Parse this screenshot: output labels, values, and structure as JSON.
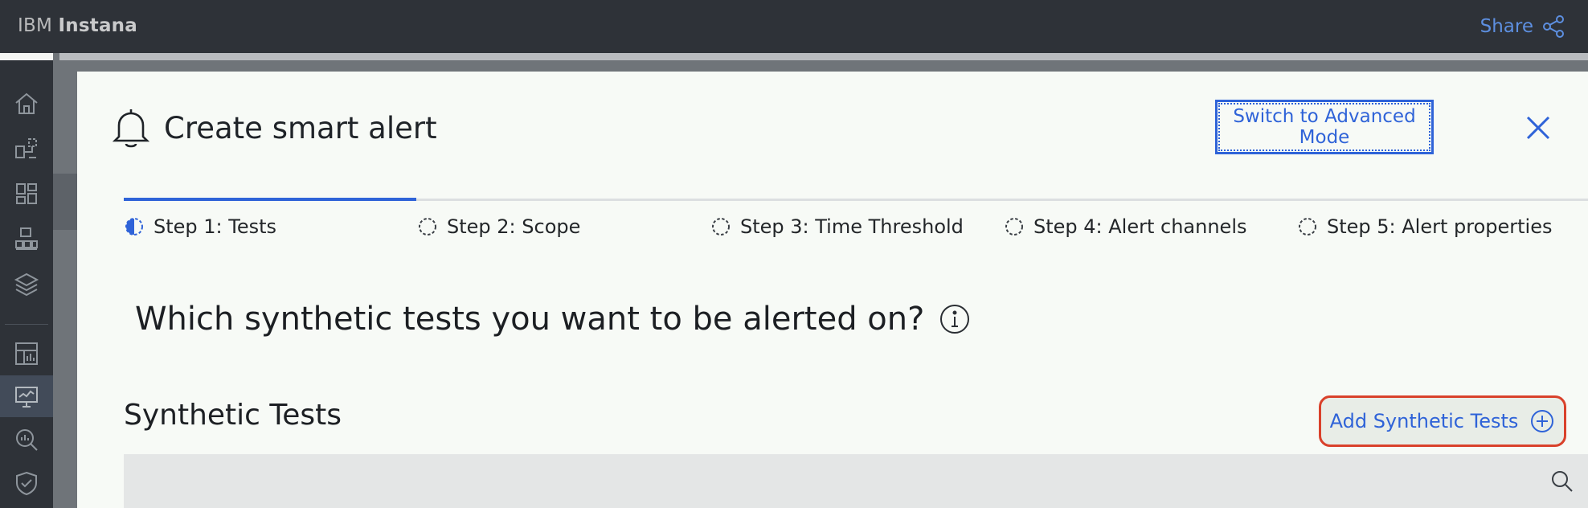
{
  "app": {
    "brand_prefix": "IBM",
    "brand_name": "Instana"
  },
  "topbar": {
    "share_label": "Share"
  },
  "nav": {
    "items": [
      {
        "icon": "home-icon"
      },
      {
        "icon": "topology-icon"
      },
      {
        "icon": "applications-icon"
      },
      {
        "icon": "infrastructure-icon"
      },
      {
        "icon": "platforms-icon"
      },
      {
        "icon": "dashboards-icon"
      },
      {
        "icon": "synthetic-monitoring-icon",
        "active": true
      },
      {
        "icon": "analyze-icon"
      },
      {
        "icon": "events-icon"
      }
    ]
  },
  "panel": {
    "title": "Create smart alert",
    "advanced_mode_label": "Switch to Advanced Mode",
    "steps": [
      {
        "label": "Step 1: Tests",
        "state": "in-progress"
      },
      {
        "label": "Step 2: Scope",
        "state": "incomplete"
      },
      {
        "label": "Step 3: Time Threshold",
        "state": "incomplete"
      },
      {
        "label": "Step 4: Alert channels",
        "state": "incomplete"
      },
      {
        "label": "Step 5: Alert properties",
        "state": "incomplete"
      }
    ],
    "question": "Which synthetic tests you want to be alerted on?",
    "section_title": "Synthetic Tests",
    "add_button_label": "Add Synthetic Tests"
  },
  "colors": {
    "accent": "#2f63d8",
    "highlight": "#d9412b",
    "chrome": "#2e3238"
  }
}
